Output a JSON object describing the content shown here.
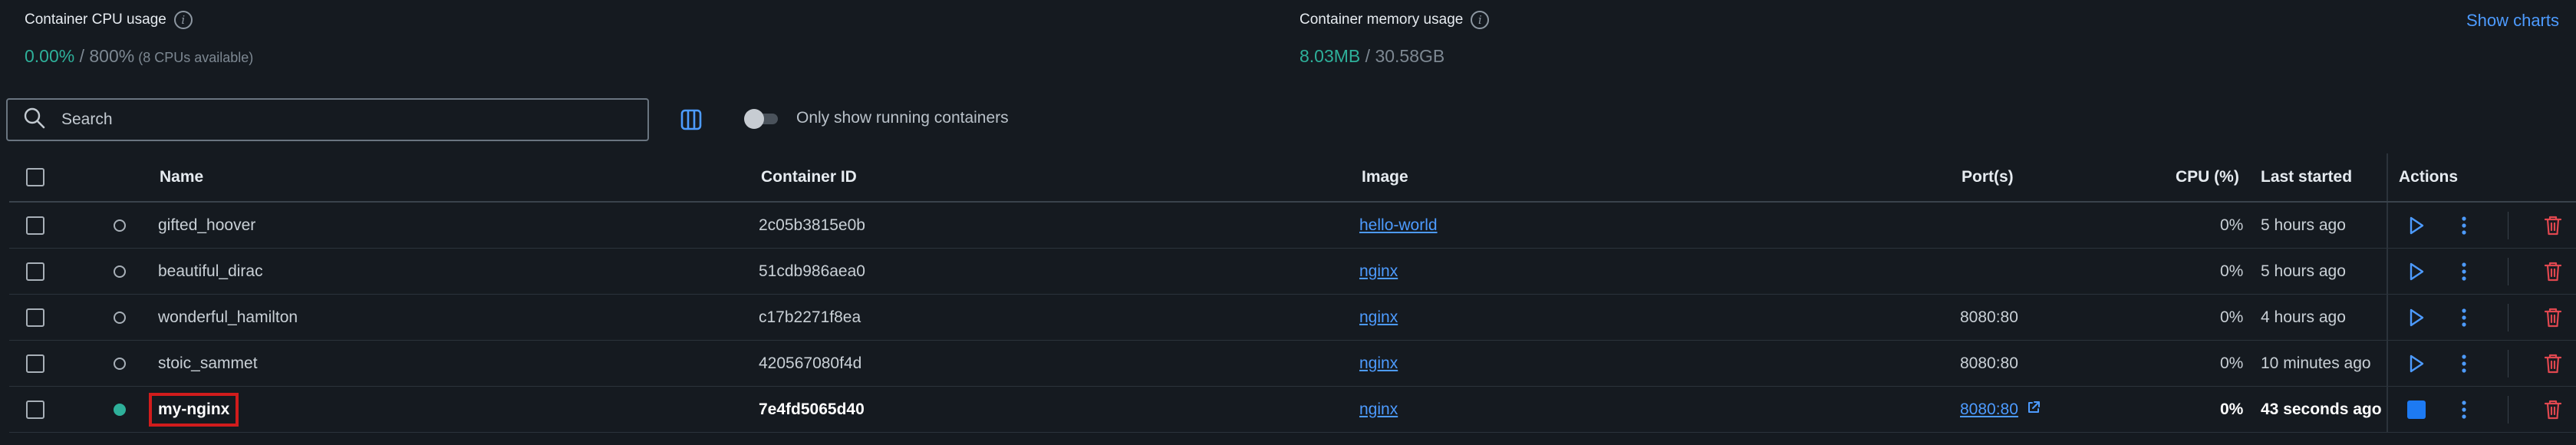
{
  "stats": {
    "cpu": {
      "label": "Container CPU usage",
      "used": "0.00%",
      "sep": " / ",
      "total": "800%",
      "note": " (8 CPUs available)"
    },
    "memory": {
      "label": "Container memory usage",
      "used": "8.03MB",
      "sep": " / ",
      "total": "30.58GB"
    },
    "show_charts_label": "Show charts"
  },
  "toolbar": {
    "search_placeholder": "Search",
    "toggle_label": "Only show running containers"
  },
  "table": {
    "headers": {
      "name": "Name",
      "container_id": "Container ID",
      "image": "Image",
      "ports": "Port(s)",
      "cpu": "CPU (%)",
      "last_started": "Last started",
      "actions": "Actions"
    },
    "rows": [
      {
        "name": "gifted_hoover",
        "container_id": "2c05b3815e0b",
        "image": "hello-world",
        "ports": "",
        "cpu": "0%",
        "last_started": "5 hours ago"
      },
      {
        "name": "beautiful_dirac",
        "container_id": "51cdb986aea0",
        "image": "nginx",
        "ports": "",
        "cpu": "0%",
        "last_started": "5 hours ago"
      },
      {
        "name": "wonderful_hamilton",
        "container_id": "c17b2271f8ea",
        "image": "nginx",
        "ports": "8080:80",
        "cpu": "0%",
        "last_started": "4 hours ago"
      },
      {
        "name": "stoic_sammet",
        "container_id": "420567080f4d",
        "image": "nginx",
        "ports": "8080:80",
        "cpu": "0%",
        "last_started": "10 minutes ago"
      },
      {
        "name": "my-nginx",
        "container_id": "7e4fd5065d40",
        "image": "nginx",
        "ports": "8080:80",
        "cpu": "0%",
        "last_started": "43 seconds ago"
      }
    ]
  },
  "colors": {
    "background": "#151a20",
    "accent": "#4d9bff",
    "running": "#2eb09a",
    "delete": "#e0474f",
    "highlight": "#d11c1c"
  }
}
